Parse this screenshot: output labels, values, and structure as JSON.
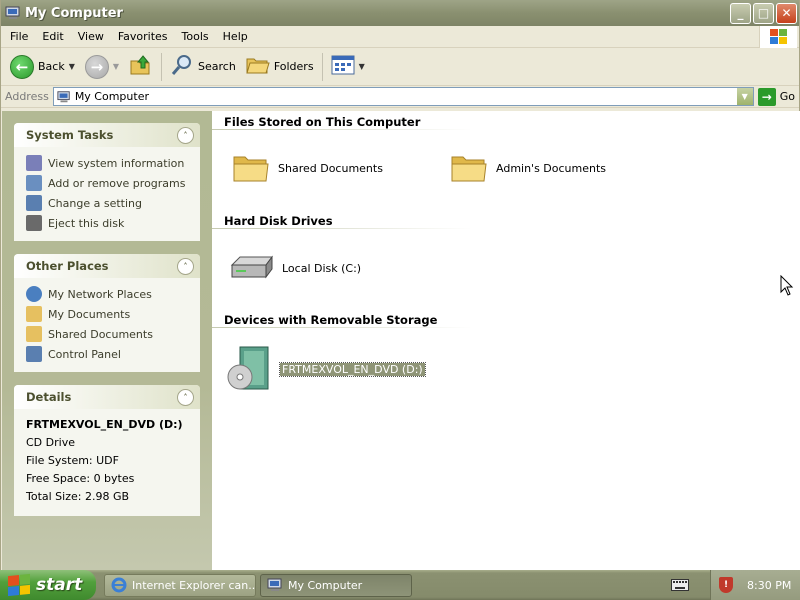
{
  "window": {
    "title": "My Computer",
    "controls": {
      "minimize": "_",
      "maximize": "□",
      "close": "✕"
    }
  },
  "menu": [
    "File",
    "Edit",
    "View",
    "Favorites",
    "Tools",
    "Help"
  ],
  "toolbar": {
    "back_label": "Back",
    "search_label": "Search",
    "folders_label": "Folders"
  },
  "address": {
    "label": "Address",
    "value": "My Computer",
    "go_label": "Go"
  },
  "system_tasks": {
    "title": "System Tasks",
    "items": [
      {
        "label": "View system information",
        "icon": "system-info-icon",
        "color": "#7a7fb8"
      },
      {
        "label": "Add or remove programs",
        "icon": "programs-icon",
        "color": "#6a8fc0"
      },
      {
        "label": "Change a setting",
        "icon": "control-panel-icon",
        "color": "#5a7fb0"
      },
      {
        "label": "Eject this disk",
        "icon": "eject-icon",
        "color": "#6a6a6a"
      }
    ]
  },
  "other_places": {
    "title": "Other Places",
    "items": [
      {
        "label": "My Network Places",
        "icon": "network-icon",
        "color": "#4a7fc0"
      },
      {
        "label": "My Documents",
        "icon": "documents-icon",
        "color": "#e6c060"
      },
      {
        "label": "Shared Documents",
        "icon": "folder-icon",
        "color": "#e6c060"
      },
      {
        "label": "Control Panel",
        "icon": "control-panel-icon",
        "color": "#5a7fb0"
      }
    ]
  },
  "details": {
    "title": "Details",
    "name": "FRTMEXVOL_EN_DVD (D:)",
    "type": "CD Drive",
    "file_system": "File System: UDF",
    "free_space": "Free Space: 0 bytes",
    "total_size": "Total Size: 2.98 GB"
  },
  "groups": {
    "files": {
      "title": "Files Stored on This Computer",
      "items": [
        "Shared Documents",
        "Admin's Documents"
      ]
    },
    "hdd": {
      "title": "Hard Disk Drives",
      "items": [
        "Local Disk (C:)"
      ]
    },
    "removable": {
      "title": "Devices with Removable Storage",
      "items": [
        "FRTMEXVOL_EN_DVD (D:)"
      ]
    }
  },
  "taskbar": {
    "start_label": "start",
    "tasks": [
      "Internet Explorer can...",
      "My Computer"
    ],
    "clock": "8:30 PM"
  }
}
